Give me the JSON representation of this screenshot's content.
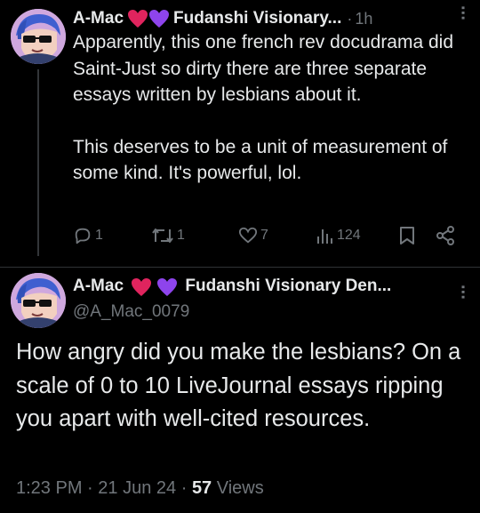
{
  "tweet1": {
    "author": "A-Mac",
    "display_suffix": "Fudanshi Visionary...",
    "separator": "·",
    "time": "1h",
    "paragraph1": "Apparently, this one french rev docudrama did Saint-Just so dirty there are three separate essays written by lesbians about it.",
    "paragraph2": "This deserves to be a unit of measurement of some kind. It's powerful, lol.",
    "replies": "1",
    "retweets": "1",
    "likes": "7",
    "views": "124"
  },
  "tweet2": {
    "author": "A-Mac",
    "display_suffix": "Fudanshi Visionary Den...",
    "handle": "@A_Mac_0079",
    "body": "How angry did you make the lesbians? On a scale of 0 to 10 LiveJournal essays ripping you apart with well-cited resources.",
    "time": "1:23 PM",
    "date": "21 Jun 24",
    "separator": "·",
    "view_count": "57",
    "views_label": "Views"
  },
  "icons": [
    "avatar-icon",
    "red-heart-icon",
    "purple-heart-icon",
    "more-icon",
    "reply-icon",
    "retweet-icon",
    "like-icon",
    "views-icon",
    "bookmark-icon",
    "share-icon"
  ],
  "colors": {
    "background": "#000000",
    "text": "#e7e9ea",
    "muted": "#71767b",
    "heart_red": "#e0245e",
    "heart_purple": "#8e44ec"
  }
}
